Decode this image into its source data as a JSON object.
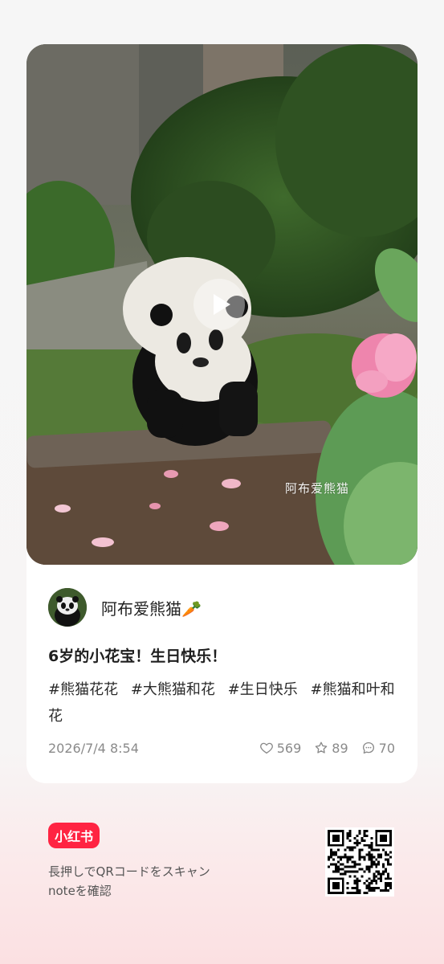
{
  "post": {
    "watermark": "阿布爱熊猫",
    "author": {
      "name": "阿布爱熊猫🥕"
    },
    "title": "6岁的小花宝！生日快乐！",
    "tags": [
      "#熊猫花花",
      "#大熊猫和花",
      "#生日快乐",
      "#熊猫和叶和花"
    ],
    "date": "2026/7/4 8:54",
    "stats": {
      "likes": "569",
      "collects": "89",
      "comments": "70"
    }
  },
  "footer": {
    "brand": "小红书",
    "scan_text_line1": "長押しでQRコードをスキャン",
    "scan_text_line2": "noteを確認"
  },
  "colors": {
    "brand_red": "#ff2442",
    "meta_gray": "#8a8a8a"
  },
  "icons": [
    "play-icon",
    "heart-icon",
    "star-icon",
    "comment-icon",
    "qr-code"
  ]
}
